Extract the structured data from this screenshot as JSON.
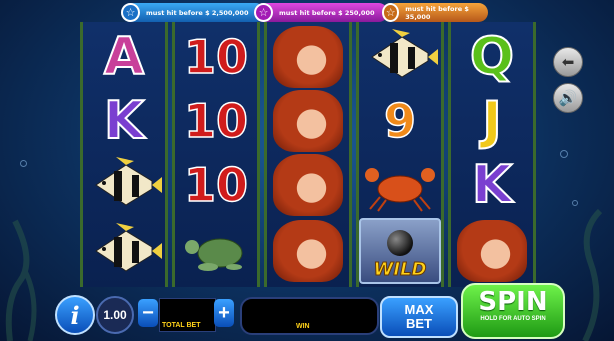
{
  "jackpots": [
    {
      "text": "must hit before $ 2,500,000",
      "color": "#1a70c6"
    },
    {
      "text": "must hit before $ 250,000",
      "color": "#a31ab5"
    },
    {
      "text": "must hit before $ 35,000",
      "color": "#c76b18"
    }
  ],
  "reels": [
    [
      "A",
      "K",
      "fish",
      "fish"
    ],
    [
      "10",
      "10",
      "10",
      "turtle"
    ],
    [
      "mermaid",
      "mermaid",
      "mermaid",
      "mermaid"
    ],
    [
      "fish",
      "9",
      "crab",
      "WILD"
    ],
    [
      "Q",
      "J",
      "K",
      "mermaid"
    ]
  ],
  "symbol_colors": {
    "A": "#c8409a",
    "K": "#7a3fd0",
    "Q": "#5ac01a",
    "J": "#f0c81a"
  },
  "controls": {
    "bet_value": "1.00",
    "total_bet_label": "TOTAL BET",
    "win_label": "WIN",
    "max_bet_label": "MAX BET",
    "spin_label": "SPIN",
    "spin_sub_label": "HOLD FOR AUTO SPIN",
    "info_label": "i",
    "minus_label": "−",
    "plus_label": "+"
  },
  "side_buttons": {
    "back_icon": "arrow-left-icon",
    "sound_icon": "speaker-icon"
  }
}
